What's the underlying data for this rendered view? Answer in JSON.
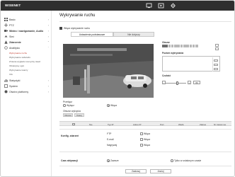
{
  "app": {
    "brand": "WISENET"
  },
  "topbar": {
    "icons": [
      "monitor-icon",
      "playback-icon",
      "settings-gear-icon"
    ]
  },
  "sidebar": {
    "items": [
      {
        "label": "Basic",
        "icon": "grid-icon"
      },
      {
        "label": "PTZ",
        "icon": "ptz-icon"
      },
      {
        "label": "Wideo i nawigowanie, Audio",
        "icon": "video-icon"
      },
      {
        "label": "Sieć",
        "icon": "network-icon"
      },
      {
        "label": "Zdarzenie",
        "icon": "event-icon"
      },
      {
        "label": "Analityka",
        "icon": "analytics-icon"
      },
      {
        "label": "Statystyki",
        "icon": "stats-icon"
      },
      {
        "label": "System",
        "icon": "system-icon"
      },
      {
        "label": "Otwórz platformy",
        "icon": "platform-icon"
      }
    ],
    "subitems": [
      "Wykrywanie ruchu",
      "Wykrywanie sabotażu",
      "Zmiana wygladu sceny/wy stawi",
      "Obiektywy ogni",
      "Wykrywanie twarzy",
      "IVA"
    ]
  },
  "main": {
    "title": "Wykrywanie ruchu",
    "enable_label": "Włącz wykrywanie ruchu",
    "tabs": [
      "Ustawienia podstawowe",
      "Nie dotyczy"
    ],
    "right": {
      "heading1": "Obszar",
      "heading2": "Poziom wykrywania",
      "heading3": "Czułość",
      "sens_value": "80"
    },
    "overlay": {
      "label": "Przełącz",
      "off": "Wyłącz",
      "on": "Włącz"
    },
    "area": {
      "label": "Obszar wykrycia",
      "buttons": [
        "Obszar",
        "Kasuj"
      ]
    },
    "table": {
      "columns": [
        "Nie",
        "Typ IP",
        "Adres IP",
        "Port",
        "Ważk.",
        "Zakres",
        "Nr zasian we"
      ]
    },
    "actions": {
      "label": "Konfig. zdarzeń",
      "rows": [
        {
          "name": "FTP",
          "value": "Włącz"
        },
        {
          "name": "E-mail",
          "value": "Włącz"
        },
        {
          "name": "Nagrywaj",
          "value": "Włącz"
        }
      ]
    },
    "schedule": {
      "label": "Czas aktywacji",
      "always": "Zawsze",
      "custom": "Tylko w ustalonym czasie"
    },
    "footer": {
      "apply": "Zastosuj",
      "cancel": "Anuluj"
    }
  }
}
